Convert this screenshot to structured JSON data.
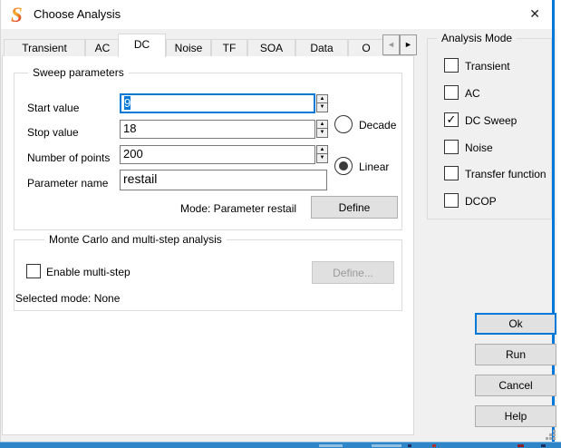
{
  "window": {
    "title": "Choose Analysis"
  },
  "icons": {
    "close": "✕",
    "checkmark": "✓",
    "spin_up": "▲",
    "spin_down": "▼",
    "tab_scroll_left": "◄",
    "tab_scroll_right": "►"
  },
  "tabs": {
    "items": [
      {
        "label": "Transient",
        "active": false
      },
      {
        "label": "AC",
        "active": false
      },
      {
        "label": "DC",
        "active": true
      },
      {
        "label": "Noise",
        "active": false
      },
      {
        "label": "TF",
        "active": false
      },
      {
        "label": "SOA",
        "active": false
      },
      {
        "label": "Data",
        "active": false
      },
      {
        "label": "O",
        "active": false,
        "clipped": true
      }
    ]
  },
  "sweep": {
    "group_title": "Sweep parameters",
    "fields": [
      {
        "label": "Start value",
        "value": "9",
        "focused": true,
        "text_selected": true,
        "spinner": true
      },
      {
        "label": "Stop value",
        "value": "18",
        "spinner": true
      },
      {
        "label": "Number of points",
        "value": "200",
        "spinner": true
      },
      {
        "label": "Parameter name",
        "value": "restail",
        "spinner": false
      }
    ],
    "radios": [
      {
        "label": "Decade",
        "checked": false
      },
      {
        "label": "Linear",
        "checked": true
      }
    ],
    "mode_text": "Mode: Parameter restail",
    "define_button": "Define"
  },
  "monte_carlo": {
    "group_title": "Monte Carlo and multi-step analysis",
    "enable_label": "Enable multi-step",
    "enable_checked": false,
    "define_button": "Define...",
    "define_enabled": false,
    "selected_mode_text": "Selected mode: None"
  },
  "analysis_mode": {
    "group_title": "Analysis Mode",
    "options": [
      {
        "label": "Transient",
        "checked": false
      },
      {
        "label": "AC",
        "checked": false
      },
      {
        "label": "DC Sweep",
        "checked": true
      },
      {
        "label": "Noise",
        "checked": false
      },
      {
        "label": "Transfer function",
        "checked": false
      },
      {
        "label": "DCOP",
        "checked": false
      }
    ]
  },
  "action_buttons": [
    {
      "label": "Ok",
      "focused": true
    },
    {
      "label": "Run",
      "focused": false
    },
    {
      "label": "Cancel",
      "focused": false
    },
    {
      "label": "Help",
      "focused": false
    }
  ],
  "colors": {
    "accent": "#0078d7",
    "selection-bg": "#0078d7",
    "dialog-bg": "#f0f0f0",
    "page-bg": "#ffffff",
    "group-border": "#dcdcdc",
    "button-face": "#e1e1e1",
    "button-border": "#adadad",
    "disabled-text": "#9a9a9a",
    "taskbar-blue": "#2e86c8",
    "logo-red": "#e2342b",
    "logo-yellow": "#f5b32d"
  }
}
